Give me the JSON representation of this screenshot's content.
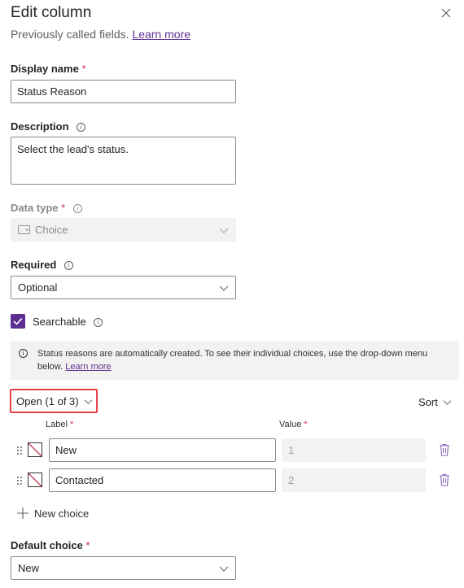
{
  "panel": {
    "title": "Edit column",
    "subtitle": "Previously called fields.",
    "learn_more": "Learn more"
  },
  "display_name": {
    "label": "Display name",
    "required_mark": "*",
    "value": "Status Reason"
  },
  "description": {
    "label": "Description",
    "info_glyph": "i",
    "value": "Select the lead's status."
  },
  "data_type": {
    "label": "Data type",
    "required_mark": "*",
    "info_glyph": "i",
    "value": "Choice",
    "icon": "choice-icon"
  },
  "required": {
    "label": "Required",
    "info_glyph": "i",
    "value": "Optional"
  },
  "searchable": {
    "label": "Searchable",
    "info_glyph": "i",
    "checked": true
  },
  "banner": {
    "info_glyph": "i",
    "text": "Status reasons are automatically created. To see their individual choices, use the drop-down menu below.",
    "link": "Learn more"
  },
  "status_filter": {
    "value": "Open (1 of 3)",
    "highlight_color": "#e8414a"
  },
  "sort": {
    "label": "Sort"
  },
  "choices_header": {
    "label": "Label",
    "value": "Value",
    "required_mark": "*"
  },
  "choices": [
    {
      "label": "New",
      "value": "1"
    },
    {
      "label": "Contacted",
      "value": "2"
    }
  ],
  "new_choice": {
    "label": "New choice"
  },
  "default_choice": {
    "label": "Default choice",
    "required_mark": "*",
    "value": "New"
  },
  "colors": {
    "accent": "#5c2e91",
    "required": "#c4314b",
    "trash": "#8764b8"
  }
}
